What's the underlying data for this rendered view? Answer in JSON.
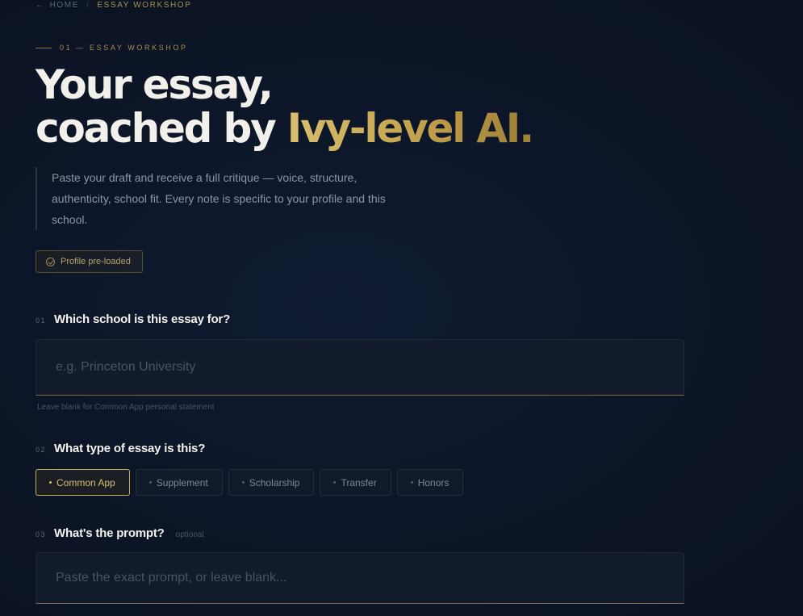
{
  "breadcrumb": {
    "back_icon": "arrow-left-icon",
    "home": "Home",
    "separator": "/",
    "current": "Essay Workshop"
  },
  "hero": {
    "eyebrow": "01 — Essay Workshop",
    "headline_line1": "Your essay,",
    "headline_line2_prefix": "coached by ",
    "headline_accent": "Ivy-level AI.",
    "lede": "Paste your draft and receive a full critique — voice, structure, authenticity, school fit. Every note is specific to your profile and this school.",
    "badge_label": "Profile pre-loaded",
    "badge_icon": "check-circle-icon"
  },
  "questions": {
    "school": {
      "number": "01",
      "label": "Which school is this essay for?",
      "placeholder": "e.g. Princeton University",
      "value": "",
      "hint": "Leave blank for Common App personal statement"
    },
    "type": {
      "number": "02",
      "label": "What type of essay is this?",
      "options": [
        "Common App",
        "Supplement",
        "Scholarship",
        "Transfer",
        "Honors"
      ],
      "selected": "Common App"
    },
    "prompt": {
      "number": "03",
      "label": "What's the prompt?",
      "optional_label": "optional",
      "placeholder": "Paste the exact prompt, or leave blank...",
      "value": ""
    }
  },
  "colors": {
    "background": "#0c1424",
    "accent_gold": "#c5a44f",
    "text_primary": "#f2f0ea",
    "text_muted": "#8e96a5"
  }
}
